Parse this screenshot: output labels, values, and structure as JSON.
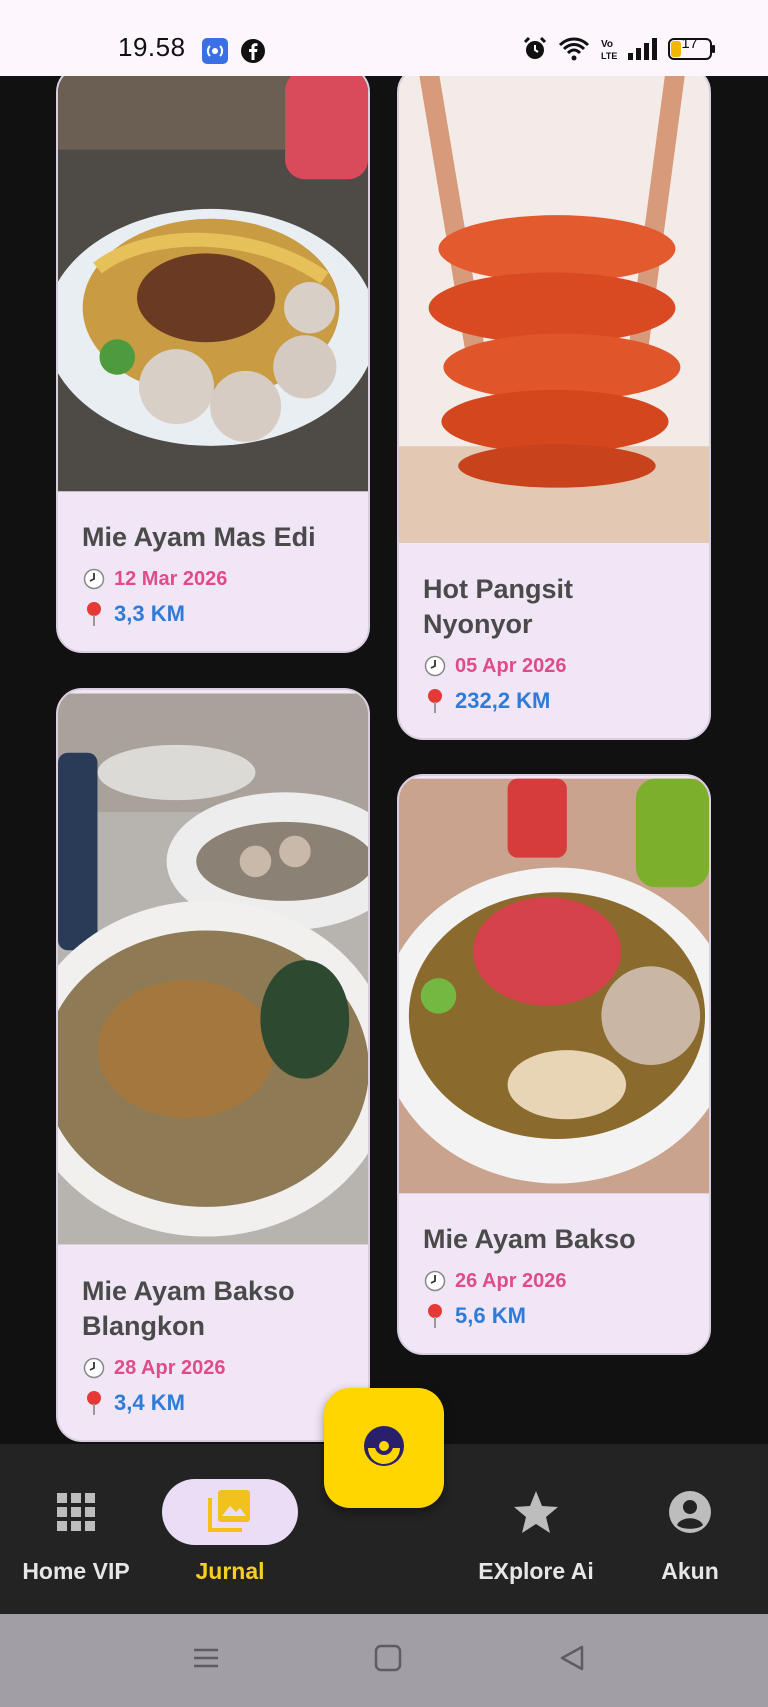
{
  "status": {
    "time": "19.58",
    "battery": "17",
    "network": "VoLTE"
  },
  "cards": [
    {
      "title": "Mie Ayam Mas Edi",
      "date": "12 Mar 2026",
      "distance": "3,3 KM",
      "photo": "noodle-meatball-plate"
    },
    {
      "title": "Hot Pangsit Nyonyor",
      "date": "05 Apr 2026",
      "distance": "232,2 KM",
      "photo": "spicy-fried-dumpling-stack"
    },
    {
      "title": "Mie Ayam Bakso Blangkon",
      "date": "28 Apr 2026",
      "distance": "3,4 KM",
      "photo": "chicken-noodle-soup-bowl"
    },
    {
      "title": "Mie Ayam Bakso",
      "date": "26 Apr 2026",
      "distance": "5,6 KM",
      "photo": "meatball-noodle-sambal-bowl"
    }
  ],
  "nav": {
    "items": [
      {
        "label": "Home VIP",
        "icon": "grid-icon"
      },
      {
        "label": "Jurnal",
        "icon": "gallery-icon"
      },
      {
        "label": "EXplore Ai",
        "icon": "star-icon"
      },
      {
        "label": "Akun",
        "icon": "account-icon"
      }
    ],
    "active": "Jurnal",
    "fab_icon": "pokeball-icon"
  },
  "colors": {
    "card_bg": "#F1E6F6",
    "date": "#E04C88",
    "distance": "#2F7BD9",
    "active_label": "#F7CF1D",
    "fab": "#FFD600"
  }
}
